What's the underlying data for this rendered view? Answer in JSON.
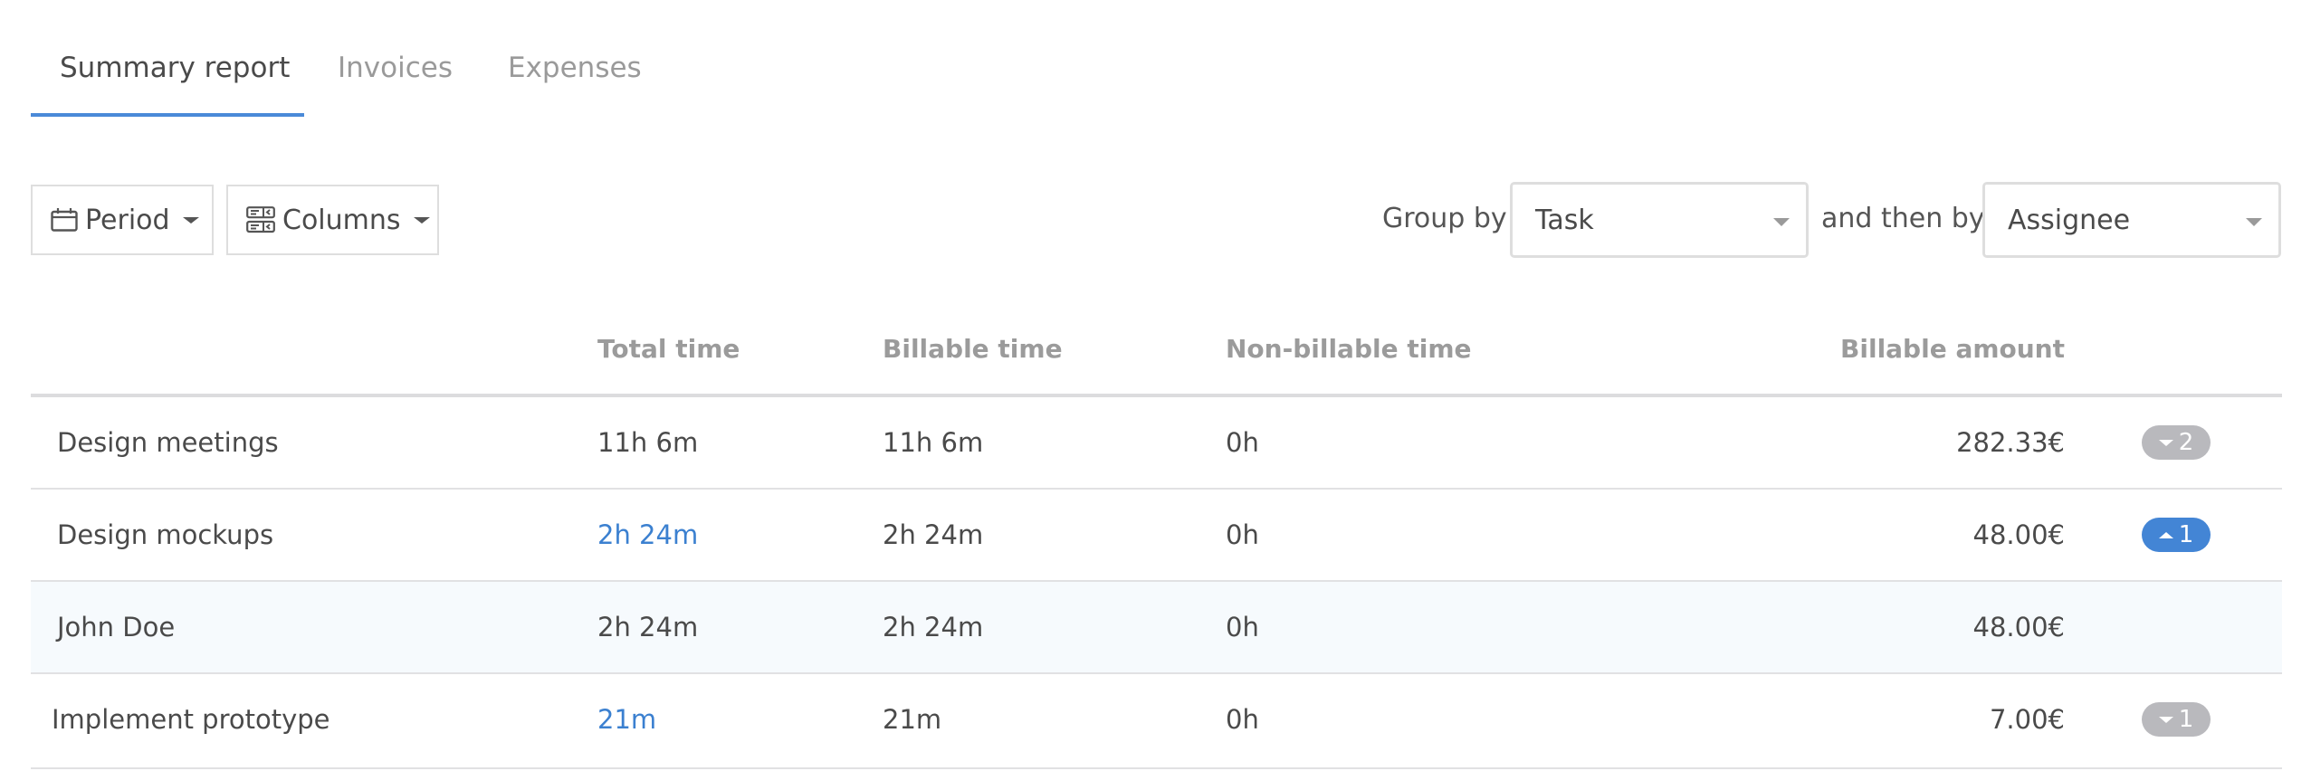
{
  "tabs": [
    {
      "label": "Summary report",
      "active": true
    },
    {
      "label": "Invoices",
      "active": false
    },
    {
      "label": "Expenses",
      "active": false
    }
  ],
  "toolbar": {
    "period": {
      "label": "Period",
      "icon": "calendar-icon"
    },
    "columns": {
      "label": "Columns",
      "icon": "columns-icon"
    },
    "group_by_label": "Group by",
    "group_by_value": "Task",
    "then_by_label": "and then by",
    "then_by_value": "Assignee"
  },
  "colors": {
    "accent": "#4a8ad8",
    "link": "#3b80d0",
    "badge_gray": "#b9b9bd",
    "badge_blue": "#4385d5",
    "highlight_row": "#f6fafd"
  },
  "table": {
    "columns": [
      "",
      "Total time",
      "Billable time",
      "Non-billable time",
      "Billable amount"
    ],
    "rows": [
      {
        "name": "Design meetings",
        "total": "11h 6m",
        "billable": "11h 6m",
        "nonbillable": "0h",
        "amount": "282.33€",
        "badge": {
          "count": "2",
          "state": "collapsed",
          "color": "gray"
        },
        "total_link": false,
        "highlight": false
      },
      {
        "name": "Design mockups",
        "total": "2h 24m",
        "billable": "2h 24m",
        "nonbillable": "0h",
        "amount": "48.00€",
        "badge": {
          "count": "1",
          "state": "expanded",
          "color": "blue"
        },
        "total_link": true,
        "highlight": false
      },
      {
        "name": "John Doe",
        "total": "2h 24m",
        "billable": "2h 24m",
        "nonbillable": "0h",
        "amount": "48.00€",
        "badge": null,
        "total_link": false,
        "highlight": true
      },
      {
        "name": "Implement prototype",
        "total": "21m",
        "billable": "21m",
        "nonbillable": "0h",
        "amount": "7.00€",
        "badge": {
          "count": "1",
          "state": "collapsed",
          "color": "gray"
        },
        "total_link": true,
        "highlight": false
      }
    ]
  }
}
